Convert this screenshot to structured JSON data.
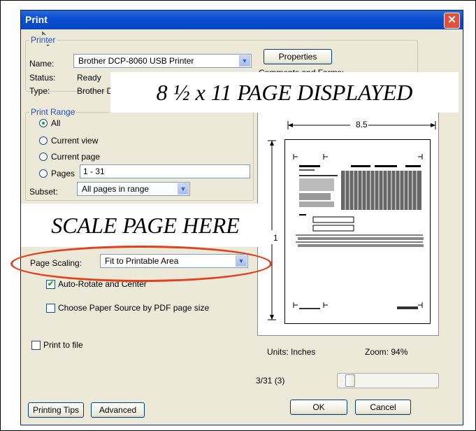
{
  "window": {
    "title": "Print",
    "close_glyph": "✕"
  },
  "printer": {
    "group_title": "Printer",
    "name_label": "Name:",
    "name_value": "Brother DCP-8060 USB Printer",
    "properties_label": "Properties",
    "status_label": "Status:",
    "status_value": "Ready",
    "type_label": "Type:",
    "type_value": "Brother D",
    "comments_partial": "Comments and Forms:"
  },
  "print_range": {
    "group_title": "Print Range",
    "options": [
      "All",
      "Current view",
      "Current page",
      "Pages"
    ],
    "selected": "All",
    "pages_value": "1 - 31",
    "subset_label": "Subset:",
    "subset_value": "All pages in range"
  },
  "handling": {
    "page_scaling_label": "Page Scaling:",
    "page_scaling_value": "Fit to Printable Area",
    "auto_rotate_label": "Auto-Rotate and Center",
    "auto_rotate_checked": true,
    "paper_source_label": "Choose Paper Source by PDF page size",
    "paper_source_checked": false
  },
  "print_to_file_label": "Print to file",
  "preview": {
    "width_label": "8.5",
    "height_label": "1",
    "units_label": "Units: Inches",
    "zoom_label": "Zoom: 94%",
    "page_counter": "3/31 (3)",
    "page_index": 3,
    "page_count": 31
  },
  "buttons": {
    "printing_tips": "Printing Tips",
    "advanced": "Advanced",
    "ok": "OK",
    "cancel": "Cancel"
  },
  "annotations": {
    "page_displayed": "8 ½ x 11 PAGE DISPLAYED",
    "scale_here": "SCALE PAGE HERE",
    "highlight_color": "#e0401e"
  }
}
